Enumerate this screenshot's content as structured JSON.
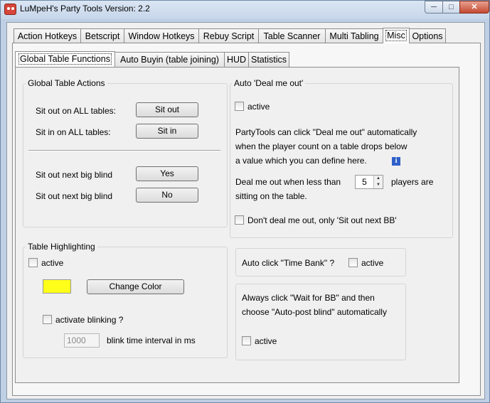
{
  "window": {
    "title": "LuMpeH's Party Tools   Version: 2.2",
    "min_glyph": "─",
    "max_glyph": "□",
    "close_glyph": "✕"
  },
  "main_tabs": [
    {
      "label": "Action Hotkeys"
    },
    {
      "label": "Betscript"
    },
    {
      "label": "Window Hotkeys"
    },
    {
      "label": "Rebuy Script"
    },
    {
      "label": "Table Scanner"
    },
    {
      "label": "Multi Tabling"
    },
    {
      "label": "Misc",
      "active": true
    },
    {
      "label": "Options"
    }
  ],
  "sub_tabs": [
    {
      "label": "Global Table Functions",
      "active": true
    },
    {
      "label": "Auto Buyin (table joining)"
    },
    {
      "label": "HUD"
    },
    {
      "label": "Statistics"
    }
  ],
  "global_actions": {
    "title": "Global Table Actions",
    "sit_out_all_label": "Sit out on ALL tables:",
    "sit_out_btn": "Sit out",
    "sit_in_all_label": "Sit in on ALL tables:",
    "sit_in_btn": "Sit in",
    "sit_out_bb_label_1": "Sit out next big blind",
    "yes_btn": "Yes",
    "sit_out_bb_label_2": "Sit out next big blind",
    "no_btn": "No"
  },
  "deal_me_out": {
    "title": "Auto 'Deal me out'",
    "active_label": "active",
    "desc_1": "PartyTools can click \"Deal me out\" automatically",
    "desc_2": "when the player count on a table drops below",
    "desc_3": "a value which you can define here.",
    "info_glyph": "i",
    "less_than_label": "Deal me out when less than",
    "player_count": "5",
    "players_label": "players are",
    "sitting_label": "sitting on the table.",
    "dont_deal_label": "Don't deal me out, only 'Sit out next BB'"
  },
  "highlighting": {
    "title": "Table Highlighting",
    "active_label": "active",
    "highlight_color": "#ffff1a",
    "change_color_btn": "Change Color",
    "blinking_label": "activate blinking ?",
    "interval_value": "1000",
    "interval_label": "blink time interval in ms"
  },
  "time_bank": {
    "label": "Auto click \"Time Bank\" ?",
    "active_label": "active"
  },
  "wait_bb": {
    "desc_1": "Always click \"Wait for BB\" and then",
    "desc_2": "choose \"Auto-post blind\" automatically",
    "active_label": "active"
  }
}
